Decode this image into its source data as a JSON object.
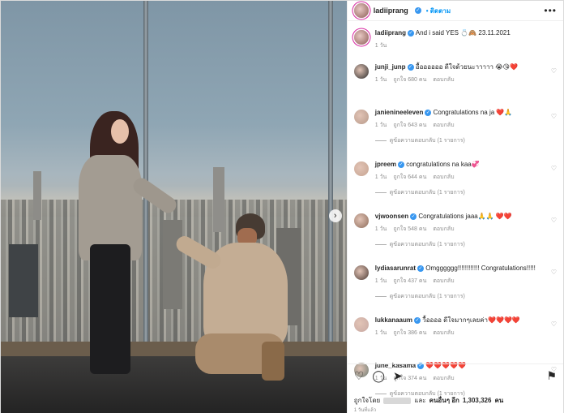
{
  "post": {
    "username": "ladiiprang",
    "follow_label": "• ติดตาม",
    "more_label": "•••",
    "carousel_next": "›"
  },
  "caption": {
    "username": "ladiiprang",
    "text": "And i said YES 💍🙈 23.11.2021",
    "age": "1 วัน"
  },
  "comments": [
    {
      "username": "junji_junp",
      "text": "อื้ออออออ ดีใจด้วยนะาาาาา 😭😘❤️",
      "age": "1 วัน",
      "likes": "ถูกใจ 680 คน",
      "reply": "ตอบกลับ",
      "replies": ""
    },
    {
      "username": "janienineeleven",
      "text": "Congratulations na ja ❤️🙏",
      "age": "1 วัน",
      "likes": "ถูกใจ 643 คน",
      "reply": "ตอบกลับ",
      "replies": "ดูข้อความตอบกลับ (1 รายการ)"
    },
    {
      "username": "jpreem",
      "text": "congratulations na kaa💞",
      "age": "1 วัน",
      "likes": "ถูกใจ 644 คน",
      "reply": "ตอบกลับ",
      "replies": "ดูข้อความตอบกลับ (1 รายการ)"
    },
    {
      "username": "vjwoonsen",
      "text": "Congratulations jaaa🙏🙏 ❤️❤️",
      "age": "1 วัน",
      "likes": "ถูกใจ 548 คน",
      "reply": "ตอบกลับ",
      "replies": "ดูข้อความตอบกลับ (1 รายการ)"
    },
    {
      "username": "lydiasarunrat",
      "text": "Omgggggg!!!!!!!!!!!! Congratulations!!!!!",
      "age": "1 วัน",
      "likes": "ถูกใจ 437 คน",
      "reply": "ตอบกลับ",
      "replies": "ดูข้อความตอบกลับ (1 รายการ)"
    },
    {
      "username": "lukkanaaum",
      "text": "วื้ออออ ดีใจมากๆเลยค่า❤️❤️❤️❤️",
      "age": "1 วัน",
      "likes": "ถูกใจ 386 คน",
      "reply": "ตอบกลับ",
      "replies": ""
    },
    {
      "username": "june_kasama",
      "text": "❤️❤️❤️❤️❤️",
      "age": "1 วัน",
      "likes": "ถูกใจ 374 คน",
      "reply": "ตอบกลับ",
      "replies": "ดูข้อความตอบกลับ (1 รายการ)"
    }
  ],
  "actions": {
    "like_icon": "heart-icon",
    "comment_icon": "comment-icon",
    "share_icon": "share-icon",
    "save_icon": "bookmark-icon"
  },
  "likes_summary": {
    "prefix": "ถูกใจโดย",
    "middle": "และ",
    "others_prefix": "คนอื่นๆ อีก",
    "count": "1,303,326",
    "suffix": "คน"
  },
  "date_label": "1 วันที่แล้ว"
}
